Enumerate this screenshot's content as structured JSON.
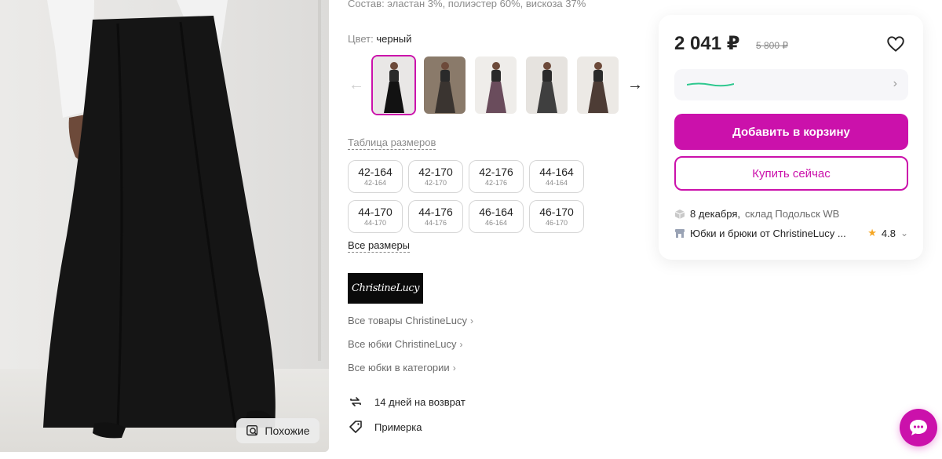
{
  "product": {
    "composition": "Состав: эластан 3%, полиэстер 60%, вискоза 37%",
    "color_label": "Цвет:",
    "color_value": "черный",
    "size_table_link": "Таблица размеров",
    "all_sizes_link": "Все размеры"
  },
  "gallery": {
    "similar_label": "Похожие",
    "prev_arrow": "←",
    "next_arrow": "→",
    "thumbs": [
      {
        "name": "black skirt",
        "bg": "#e9e7e6",
        "color": "#121212",
        "active": true
      },
      {
        "name": "plaid skirt",
        "bg": "#8a7a6a",
        "color": "#3a3430",
        "active": false
      },
      {
        "name": "plaid skirt pink",
        "bg": "#efedea",
        "color": "#6a4c5c",
        "active": false
      },
      {
        "name": "grey skirt",
        "bg": "#e6e3df",
        "color": "#3f3f3f",
        "active": false
      },
      {
        "name": "brown skirt",
        "bg": "#ece9e5",
        "color": "#4d3c35",
        "active": false
      }
    ]
  },
  "sizes": [
    {
      "main": "42-164",
      "sub": "42-164"
    },
    {
      "main": "42-170",
      "sub": "42-170"
    },
    {
      "main": "42-176",
      "sub": "42-176"
    },
    {
      "main": "44-164",
      "sub": "44-164"
    },
    {
      "main": "44-170",
      "sub": "44-170"
    },
    {
      "main": "44-176",
      "sub": "44-176"
    },
    {
      "main": "46-164",
      "sub": "46-164"
    },
    {
      "main": "46-170",
      "sub": "46-170"
    }
  ],
  "brand": {
    "logo_text": "ChristineLucy",
    "links": [
      "Все товары ChristineLucy",
      "Все юбки ChristineLucy",
      "Все юбки в категории"
    ]
  },
  "features": {
    "return_text": "14 дней на возврат",
    "fitting_text": "Примерка"
  },
  "buy": {
    "price": "2 041 ₽",
    "old_price": "5 800 ₽",
    "add_to_cart": "Добавить в корзину",
    "buy_now": "Купить сейчас",
    "delivery_date": "8 декабря,",
    "warehouse": "склад Подольск WB",
    "seller_name": "Юбки и брюки от ChristineLucy ...",
    "rating": "4.8",
    "accent_color": "#cb11ab"
  }
}
